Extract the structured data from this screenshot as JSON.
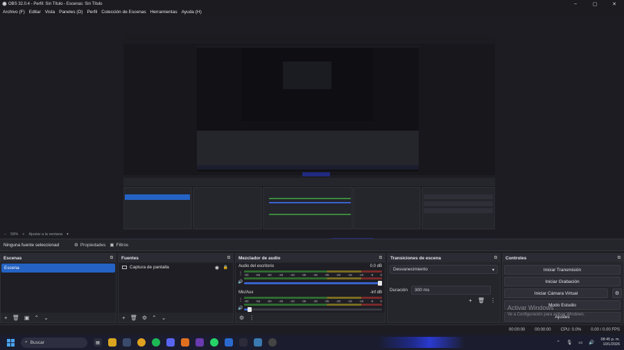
{
  "window": {
    "title": "OBS 32.0.4 - Perfil: Sin Título - Escenas: Sin Título"
  },
  "menu": [
    "Archivo (F)",
    "Editar",
    "Vista",
    "Paneles (D)",
    "Perfil",
    "Colección de Escenas",
    "Herramientas",
    "Ayuda (H)"
  ],
  "zoom": {
    "value": "59%",
    "fit_label": "Ajustar a la ventana"
  },
  "source_bar": {
    "no_source": "Ninguna fuente seleccionad",
    "properties": "Propiedades",
    "filters": "Filtros"
  },
  "scenes": {
    "title": "Escenas",
    "items": [
      "Escena"
    ]
  },
  "sources": {
    "title": "Fuentes",
    "items": [
      "Captura de pantalla"
    ]
  },
  "mixer": {
    "title": "Mezclador de audio",
    "scale": [
      "-60",
      "-55",
      "-50",
      "-45",
      "-40",
      "-35",
      "-30",
      "-25",
      "-20",
      "-15",
      "-10",
      "-5",
      "0"
    ],
    "channels": [
      {
        "name": "Audio del escritorio",
        "db": "0.0 dB",
        "level": 1.0
      },
      {
        "name": "Mic/Aux",
        "db": "-inf dB",
        "level": 0.04
      }
    ]
  },
  "transitions": {
    "title": "Transiciones de escena",
    "selected": "Desvanecimiento",
    "duration_label": "Duración",
    "duration_value": "300 ms"
  },
  "controls": {
    "title": "Controles",
    "start_streaming": "Iniciar Transmisión",
    "start_recording": "Iniciar Grabación",
    "start_virtual_cam": "Iniciar Cámara Virtual",
    "studio_mode": "Modo Estudio",
    "settings": "Ajustes"
  },
  "watermark": {
    "line1": "Activar Windows",
    "line2": "Ve a Configuración para activar Windows."
  },
  "status": {
    "rec_time": "00:00:00",
    "stream_time": "00:00:00",
    "cpu": "CPU: 0.0%",
    "fps": "0.00 / 0.00 FPS"
  },
  "taskbar": {
    "search": "Buscar",
    "time": "08:45 p. m.",
    "date": "10/1/2026"
  },
  "colors": {
    "accent": "#2463c4",
    "bg": "#1e1e23",
    "taskbar": "#1b1d2e"
  }
}
